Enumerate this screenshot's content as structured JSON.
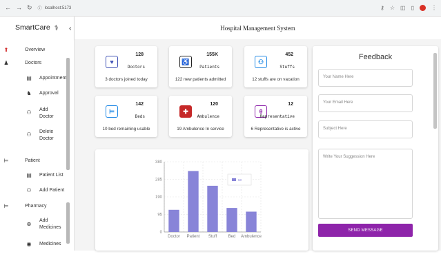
{
  "browser": {
    "url": "localhost:5173"
  },
  "app": {
    "brand": "SmartCare",
    "page_title": "Hospital Management System"
  },
  "sidebar": {
    "items": [
      {
        "label": "Overview",
        "icon": "home-icon"
      },
      {
        "label": "Doctors",
        "icon": "doctor-icon"
      },
      {
        "label": "Appointment",
        "icon": "calendar-icon"
      },
      {
        "label": "Approval",
        "icon": "users-icon"
      },
      {
        "label": "Add Doctor",
        "icon": "person-add-icon"
      },
      {
        "label": "Delete Doctor",
        "icon": "person-remove-icon"
      },
      {
        "label": "Patient",
        "icon": "bed-icon"
      },
      {
        "label": "Patient List",
        "icon": "list-icon"
      },
      {
        "label": "Add Patient",
        "icon": "person-add-icon"
      },
      {
        "label": "Pharmacy",
        "icon": "bed-icon"
      },
      {
        "label": "Add Medicines",
        "icon": "plus-box-icon"
      },
      {
        "label": "Medicines",
        "icon": "pill-icon"
      }
    ]
  },
  "stats": [
    {
      "value": "128",
      "label": "Doctors",
      "sub": "3 doctors joined today",
      "color": "#3f51b5",
      "icon": "heart-shield-icon"
    },
    {
      "value": "155K",
      "label": "Patients",
      "sub": "122 new patients admitted",
      "color": "#222222",
      "icon": "wheelchair-icon"
    },
    {
      "value": "452",
      "label": "Stuffs",
      "sub": "12 stuffs are on vacation",
      "color": "#1e88e5",
      "icon": "group-icon"
    },
    {
      "value": "142",
      "label": "Beds",
      "sub": "10 bed remaining usable",
      "color": "#1e88e5",
      "icon": "bed-icon"
    },
    {
      "value": "120",
      "label": "Ambulence",
      "sub": "19 Ambulence In service",
      "color": "#c62828",
      "icon": "ambulance-icon"
    },
    {
      "value": "12",
      "label": "Representative",
      "sub": "6 Representative is active",
      "color": "#8e24aa",
      "icon": "person-badge-icon"
    }
  ],
  "feedback": {
    "title": "Feedback",
    "name_placeholder": "Your Name Here",
    "email_placeholder": "Your Email Here",
    "subject_placeholder": "Subject Here",
    "message_placeholder": "Write Your Suggession Here",
    "submit_label": "SEND MESSAGE",
    "accent": "#8e24aa"
  },
  "chart_data": {
    "type": "bar",
    "categories": [
      "Doctor",
      "Patient",
      "Stuff",
      "Bed",
      "Ambulence"
    ],
    "series": [
      {
        "name": "uv",
        "values": [
          120,
          330,
          250,
          130,
          110
        ],
        "color": "#8884d8"
      }
    ],
    "yticks": [
      "0",
      "95",
      "190",
      "285",
      "380"
    ],
    "ylim": [
      0,
      380
    ],
    "grid": true,
    "legend": "top-right"
  }
}
